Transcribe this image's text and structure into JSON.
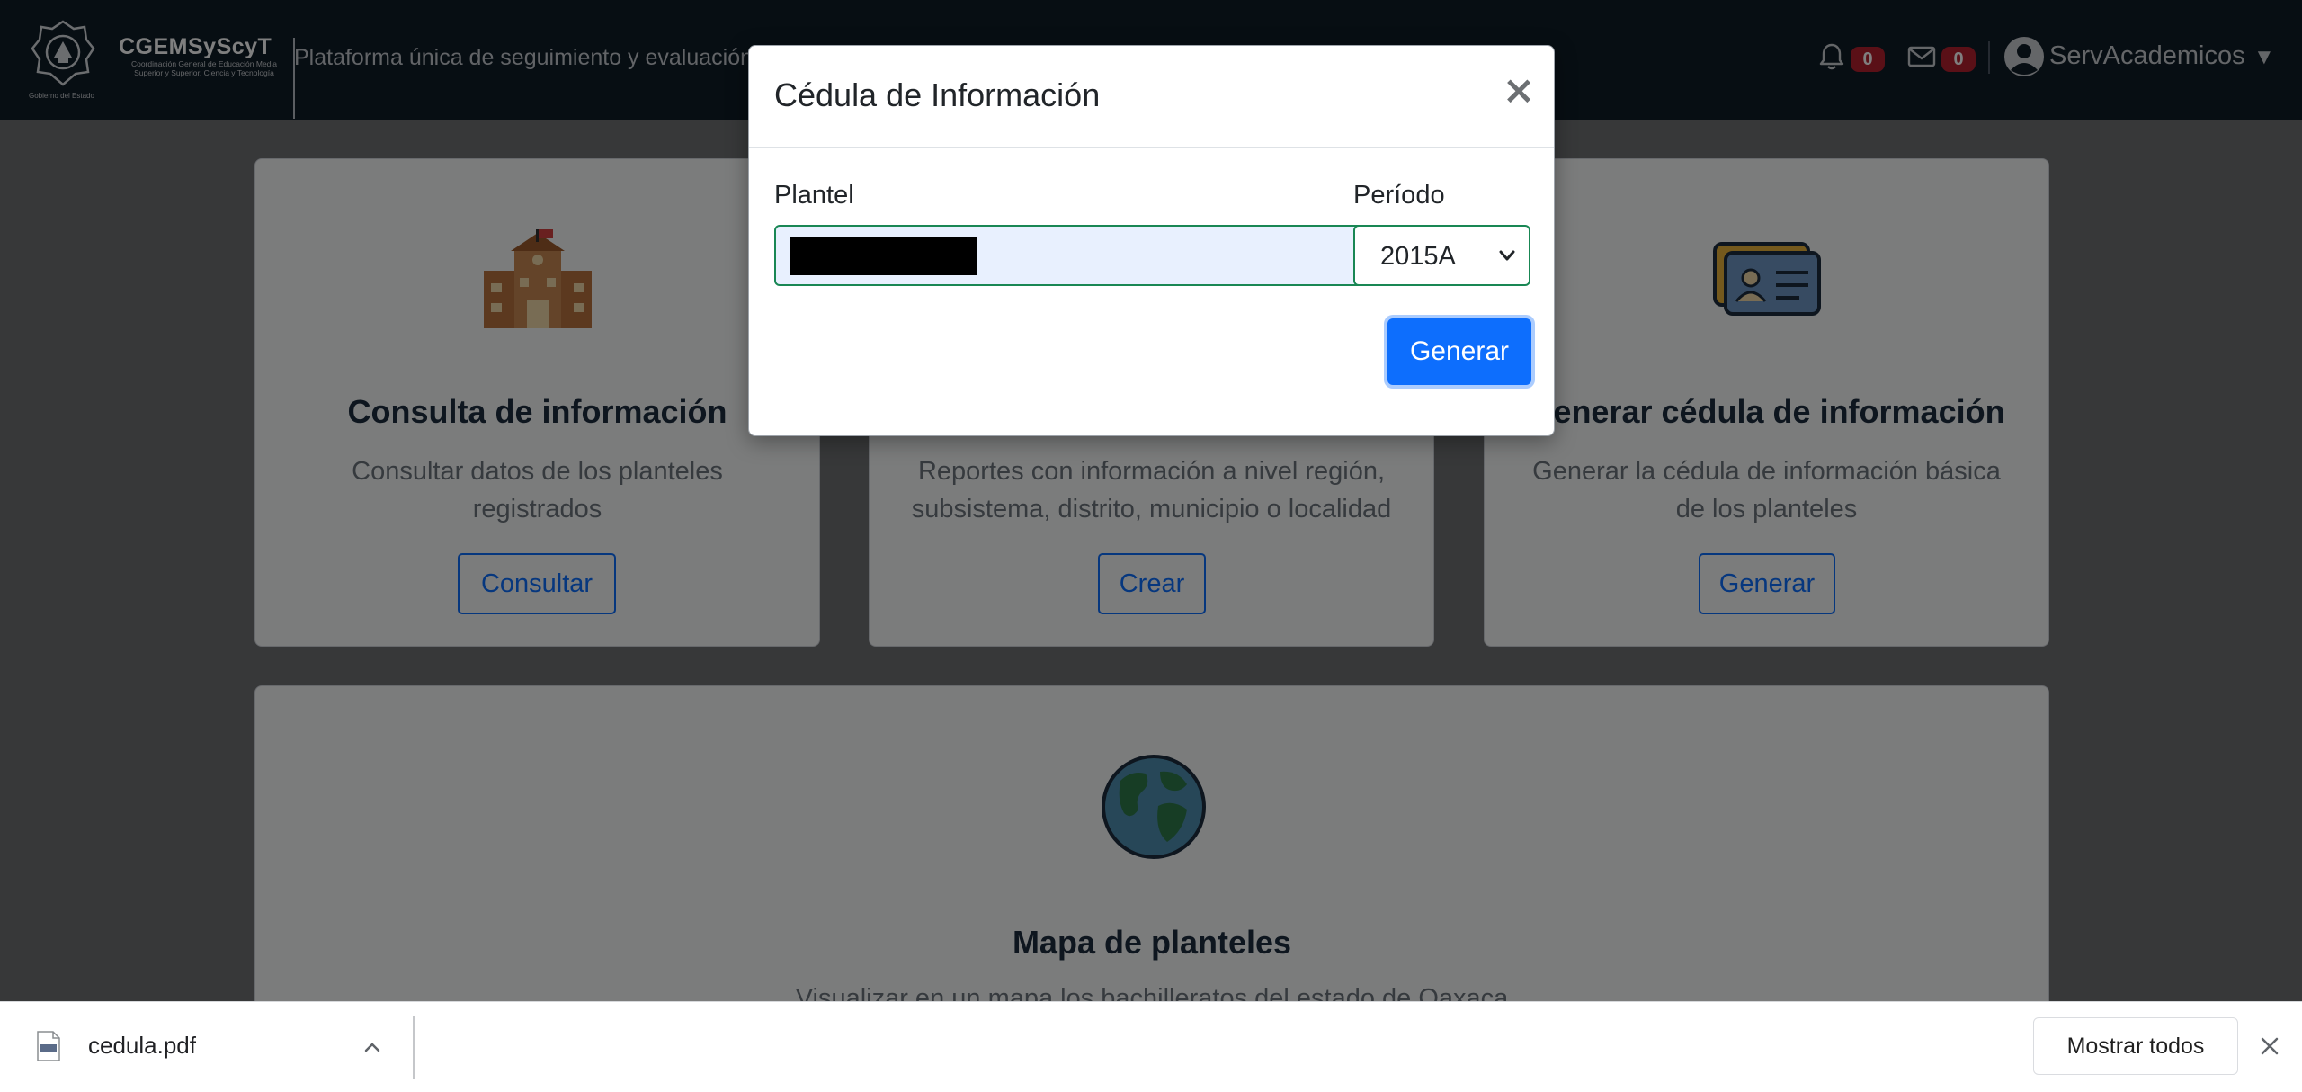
{
  "navbar": {
    "brand": "CGEMSyScyT",
    "brand_sub": "Coordinación General de Educación Media Superior y Superior, Ciencia y Tecnología",
    "gob_label": "Gobierno del Estado",
    "platform_title": "Plataforma única de seguimiento y evaluación",
    "notifications_count": "0",
    "messages_count": "0",
    "user_name": "ServAcademicos",
    "user_caret": "▼"
  },
  "cards": [
    {
      "title": "Consulta de información",
      "text": "Consultar datos de los planteles registrados",
      "button": "Consultar",
      "icon": "school-building-icon"
    },
    {
      "title": "",
      "text": "Reportes con información a nivel región, subsistema, distrito, municipio o localidad",
      "button": "Crear",
      "icon": ""
    },
    {
      "title": "Generar cédula de información",
      "text": "Generar la cédula de información básica de los planteles",
      "button": "Generar",
      "icon": "id-card-icon"
    },
    {
      "title": "Mapa de planteles",
      "text": "Visualizar en un mapa los bachilleratos del estado de Oaxaca",
      "button": "",
      "icon": "globe-icon"
    }
  ],
  "modal": {
    "title": "Cédula de Información",
    "close": "×",
    "plantel_label": "Plantel",
    "periodo_label": "Período",
    "periodo_value": "2015A",
    "submit": "Generar"
  },
  "download_bar": {
    "file_name": "cedula.pdf",
    "show_all": "Mostrar todos"
  },
  "colors": {
    "navbar": "#0f1c27",
    "primary": "#0d6efd",
    "valid_border": "#198754",
    "badge": "#b5202e"
  }
}
